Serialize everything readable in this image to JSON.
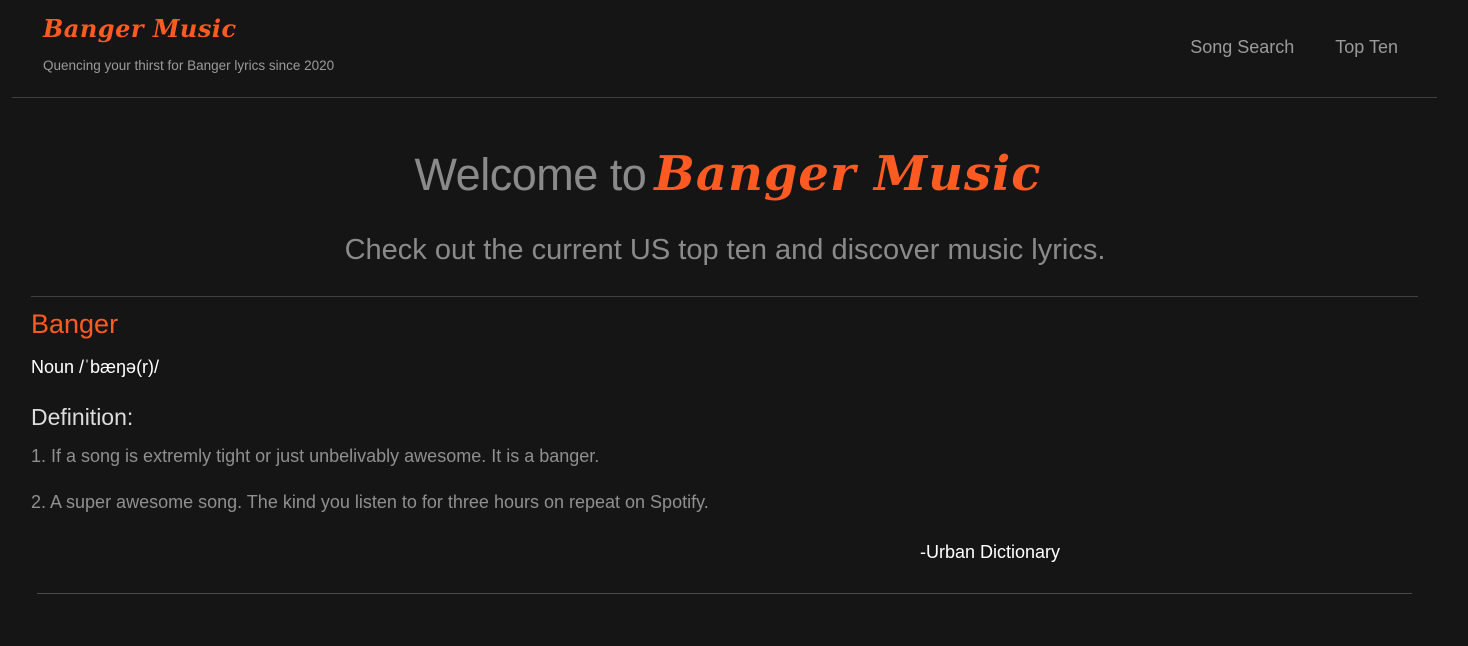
{
  "header": {
    "brand": "Banger Music",
    "tagline": "Quencing your thirst for Banger lyrics since 2020",
    "nav": [
      {
        "label": "Song Search"
      },
      {
        "label": "Top Ten"
      }
    ]
  },
  "hero": {
    "welcome": "Welcome to",
    "brand": "Banger Music",
    "subtitle": "Check out the current US top ten and discover music lyrics."
  },
  "definition": {
    "word": "Banger",
    "part_of_speech": "Noun /ˈbæŋə(r)/",
    "heading": "Definition:",
    "items": [
      "1. If a song is extremly tight or just unbelivably awesome. It is a banger.",
      "2. A super awesome song. The kind you listen to for three hours on repeat on Spotify."
    ],
    "source": "-Urban Dictionary"
  },
  "colors": {
    "background": "#151515",
    "accent": "#ff5a22",
    "muted_text": "#8a8a8a",
    "divider": "#3f3f3f"
  }
}
